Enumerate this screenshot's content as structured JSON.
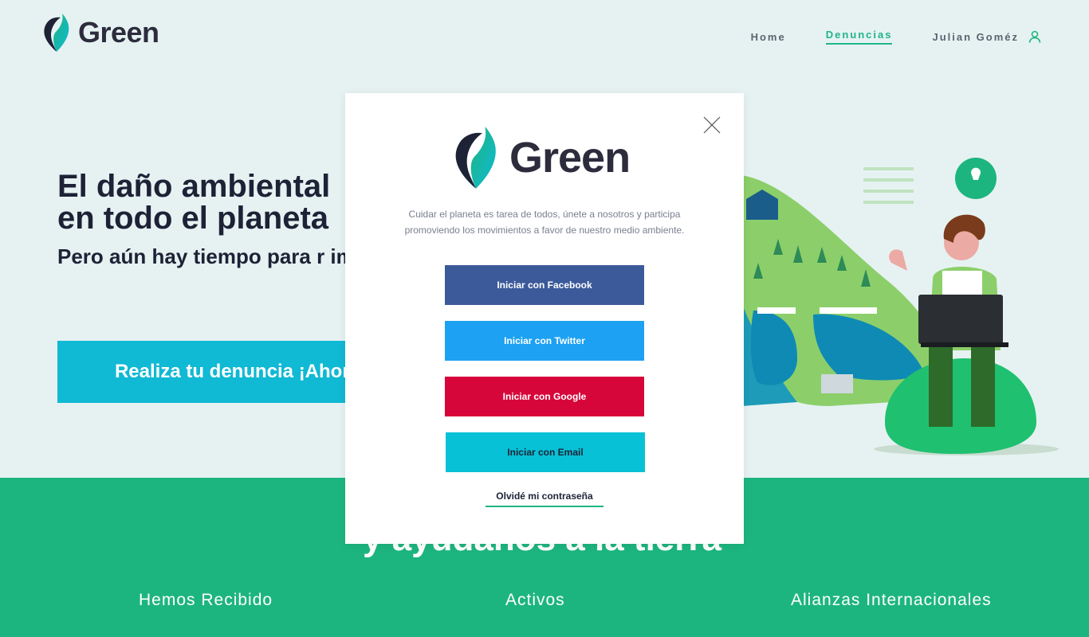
{
  "header": {
    "logo_text": "Green",
    "nav": {
      "home": "Home",
      "denuncias": "Denuncias",
      "user": "Julian Goméz"
    }
  },
  "hero": {
    "title_line1": "El daño ambiental",
    "title_line2": "en todo el planeta",
    "subtitle": "Pero aún hay tiempo para r impacto.",
    "cta_label": "Realiza tu denuncia ¡Ahora!"
  },
  "stats": {
    "hidden_title": "y ayúdanos a la tierra",
    "items": [
      {
        "label": "Hemos Recibido"
      },
      {
        "label": "Activos"
      },
      {
        "label": "Alianzas Internacionales"
      }
    ]
  },
  "modal": {
    "logo_text": "Green",
    "description": "Cuidar el planeta es tarea de todos, únete a nosotros y participa promoviendo los movimientos a favor de nuestro medio ambiente.",
    "buttons": {
      "facebook": "Iniciar con Facebook",
      "twitter": "Iniciar con Twitter",
      "google": "Iniciar con Google",
      "email": "Iniciar con Email"
    },
    "forgot": "Olvidé mi contraseña"
  },
  "colors": {
    "brand_green": "#1db57f",
    "cta_cyan": "#10b9d4",
    "facebook": "#3c5a9a",
    "twitter": "#1da1f2",
    "google": "#d7063a",
    "email": "#07c1d6"
  }
}
